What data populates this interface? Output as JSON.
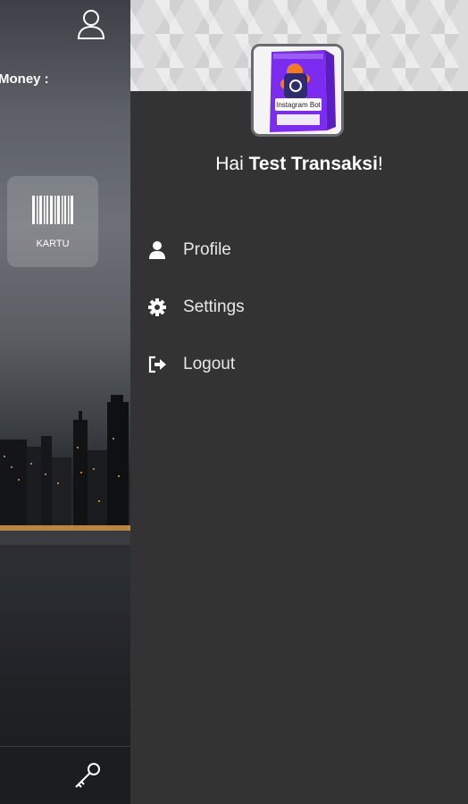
{
  "background_app": {
    "money_label": "Money :",
    "card_label": "KARTU"
  },
  "drawer": {
    "greeting_prefix": "Hai ",
    "user_name": "Test Transaksi",
    "greeting_suffix": "!",
    "logo_title": "Instagram Bot",
    "menu": [
      {
        "label": "Profile",
        "icon": "person-icon"
      },
      {
        "label": "Settings",
        "icon": "gear-icon"
      },
      {
        "label": "Logout",
        "icon": "logout-icon"
      }
    ]
  },
  "colors": {
    "drawer_bg": "#333333",
    "text": "#ffffff",
    "logo_purple": "#7b2cf0",
    "logo_orange": "#f47a1f"
  }
}
